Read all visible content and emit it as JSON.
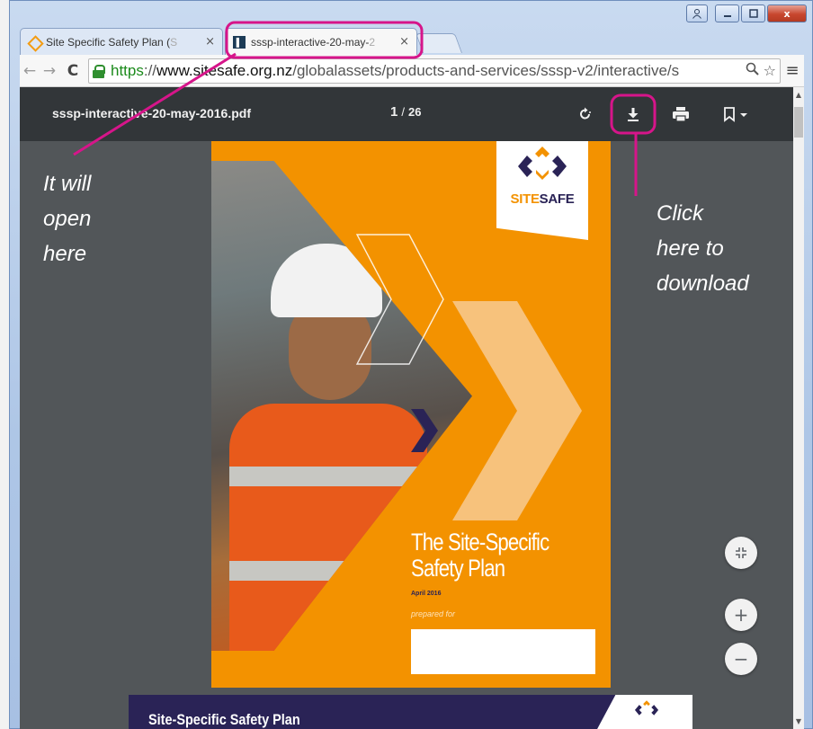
{
  "window": {
    "caption_buttons": {
      "user_icon": "user-icon",
      "minimize_icon": "minimize-icon",
      "maximize_icon": "maximize-icon",
      "close_glyph": "x"
    }
  },
  "tabs": [
    {
      "title_visible": "Site Specific Safety Plan (",
      "title_faded": "S",
      "close": "×",
      "icon": "sitesafe-favicon"
    },
    {
      "title_visible": "sssp-interactive-20-may-",
      "title_faded": "2",
      "close": "×",
      "icon": "pdf-favicon",
      "active": true
    }
  ],
  "toolbar": {
    "back": "←",
    "forward": "→",
    "reload": "C",
    "url_scheme": "https",
    "url_sep": "://",
    "url_domain": "www.sitesafe.org.nz",
    "url_path": "/globalassets/products-and-services/sssp-v2/interactive/",
    "url_tail": "s",
    "zoom_icon": "🔍",
    "star_icon": "☆",
    "menu": "≡"
  },
  "pdf_viewer": {
    "filename": "sssp-interactive-20-may-2016.pdf",
    "current_page": "1",
    "separator": "/",
    "total_pages": "26",
    "tools": [
      "rotate-icon",
      "download-icon",
      "print-icon",
      "bookmark-icon"
    ]
  },
  "cover": {
    "logo_site": "SITE",
    "logo_safe": "SAFE",
    "title_line1": "The Site-Specific",
    "title_line2": "Safety Plan",
    "date": "April 2016",
    "prepared_for": "prepared for"
  },
  "page2": {
    "title": "Site-Specific Safety Plan"
  },
  "fabs": {
    "fit": "⋰",
    "zoom_in": "+",
    "zoom_out": "−"
  },
  "annotations": {
    "left_lines": [
      "It will",
      "open",
      "here"
    ],
    "right_lines": [
      "Click",
      "here to",
      "download"
    ],
    "highlight_color": "#d6158a"
  },
  "colors": {
    "sitesafe_orange": "#f39200",
    "sitesafe_navy": "#2a2356",
    "viewer_bg": "#525659",
    "viewer_bar": "#323639"
  }
}
